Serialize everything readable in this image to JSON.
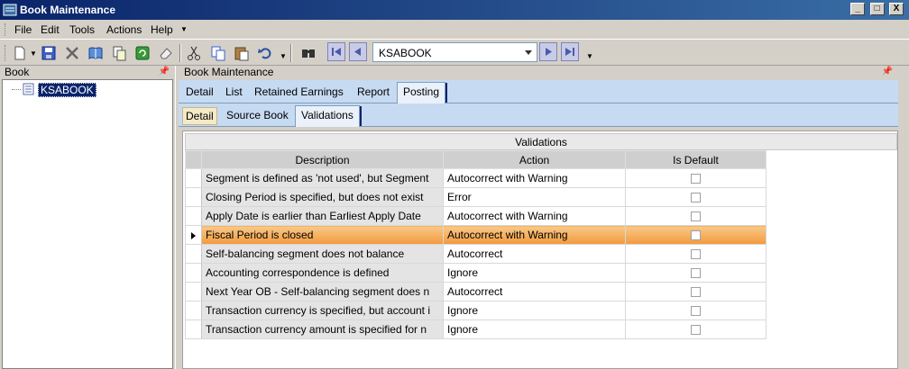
{
  "window": {
    "title": "Book Maintenance",
    "controls": [
      "_",
      "□",
      "X"
    ]
  },
  "menu": {
    "items": [
      "File",
      "Edit",
      "Tools",
      "Actions",
      "Help"
    ]
  },
  "toolbar": {
    "book_value": "KSABOOK"
  },
  "left_pane": {
    "header": "Book",
    "tree_item": "KSABOOK"
  },
  "right_pane": {
    "header": "Book Maintenance",
    "tabs": [
      "Detail",
      "List",
      "Retained Earnings",
      "Report",
      "Posting"
    ],
    "active_tab": "Posting",
    "subtabs": [
      "Detail",
      "Source Book",
      "Validations"
    ],
    "active_subtab": "Validations"
  },
  "grid": {
    "title": "Validations",
    "columns": [
      "Description",
      "Action",
      "Is Default"
    ],
    "rows": [
      {
        "description": "Segment is defined as 'not used', but Segment",
        "action": "Autocorrect with Warning",
        "is_default": false
      },
      {
        "description": "Closing Period is specified, but does not exist",
        "action": "Error",
        "is_default": false
      },
      {
        "description": "Apply Date is earlier than Earliest Apply Date",
        "action": "Autocorrect with Warning",
        "is_default": false
      },
      {
        "description": "Fiscal Period is closed",
        "action": "Autocorrect with Warning",
        "is_default": false,
        "current": true
      },
      {
        "description": "Self-balancing segment does not balance",
        "action": "Autocorrect",
        "is_default": false
      },
      {
        "description": "Accounting correspondence is defined",
        "action": "Ignore",
        "is_default": false
      },
      {
        "description": "Next Year OB - Self-balancing segment does n",
        "action": "Autocorrect",
        "is_default": false
      },
      {
        "description": "Transaction currency is specified, but account i",
        "action": "Ignore",
        "is_default": false
      },
      {
        "description": "Transaction currency amount is specified for n",
        "action": "Ignore",
        "is_default": false
      }
    ]
  }
}
